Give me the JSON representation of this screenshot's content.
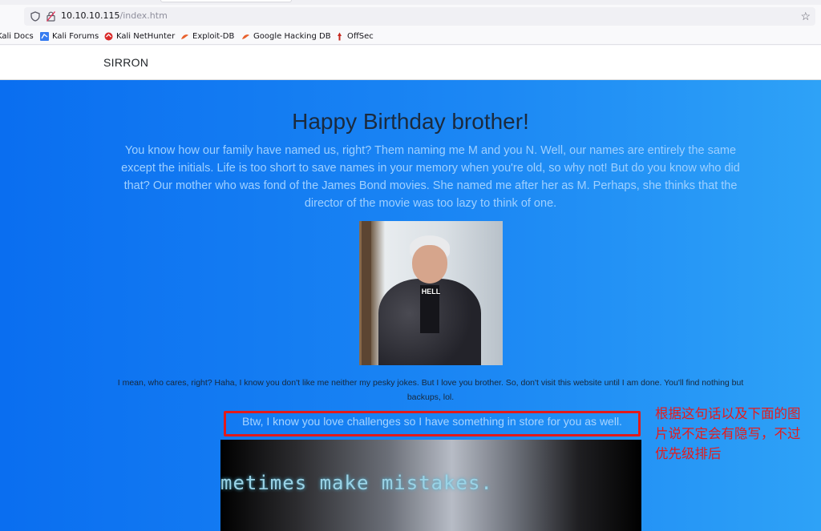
{
  "browser": {
    "url_host": "10.10.10.115",
    "url_path": "/index.htm",
    "bookmarks": [
      {
        "label": "Kali Docs",
        "icon": "kali-dragon-icon"
      },
      {
        "label": "Kali Forums",
        "icon": "kali-forums-icon"
      },
      {
        "label": "Kali NetHunter",
        "icon": "nethunter-icon"
      },
      {
        "label": "Exploit-DB",
        "icon": "exploit-db-icon"
      },
      {
        "label": "Google Hacking DB",
        "icon": "ghdb-icon"
      },
      {
        "label": "OffSec",
        "icon": "offsec-icon"
      }
    ]
  },
  "site": {
    "brand": "SIRRON",
    "heading": "Happy Birthday brother!",
    "intro": "You know how our family have named us, right? Them naming me M and you N. Well, our names are entirely the same except the initials. Life is too short to save names in your memory when you're old, so why not! But do you know who did that? Our mother who was fond of the James Bond movies. She named me after her as M. Perhaps, she thinks that the director of the movie was too lazy to think of one.",
    "image_caption": "HELL",
    "note": "I mean, who cares, right? Haha, I know you don't like me neither my pesky jokes. But I love you brother. So, don't visit this website until I am done. You'll find nothing but backups, lol.",
    "challenge": "Btw, I know you love challenges so I have something in store for you as well.",
    "gif_text": "metimes make mistakes."
  },
  "annotation": {
    "text": "根据这句话以及下面的图片说不定会有隐写，不过优先级排后",
    "color": "#e51b1b"
  },
  "colors": {
    "hero_start": "#0a6ef0",
    "hero_end": "#2ea2f7",
    "highlight_box": "#e21a1a"
  }
}
